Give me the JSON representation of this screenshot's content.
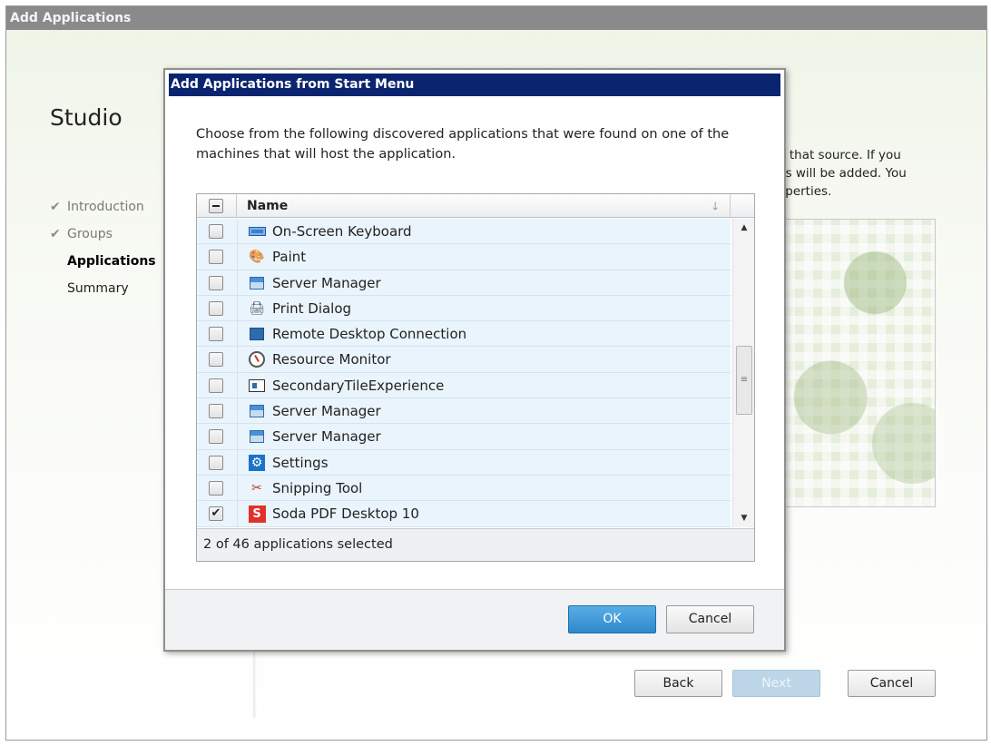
{
  "wizard": {
    "title": "Add Applications",
    "product": "Studio",
    "steps": [
      {
        "label": "Introduction",
        "state": "done"
      },
      {
        "label": "Groups",
        "state": "done"
      },
      {
        "label": "Applications",
        "state": "current"
      },
      {
        "label": "Summary",
        "state": "pending"
      }
    ],
    "background_text": [
      "n that source. If you",
      "ps will be added. You",
      "operties."
    ],
    "buttons": {
      "back": "Back",
      "next": "Next",
      "cancel": "Cancel"
    }
  },
  "dialog": {
    "title": "Add Applications from Start Menu",
    "description": "Choose from the following discovered applications that were found on one of the machines that will host the application.",
    "list": {
      "column_header": "Name",
      "sort_glyph": "🡓",
      "header_checkbox_state": "partial",
      "items": [
        {
          "label": "On-Screen Keyboard",
          "icon": "keyboard-icon",
          "checked": false
        },
        {
          "label": "Paint",
          "icon": "paint-icon",
          "checked": false
        },
        {
          "label": "Server Manager",
          "icon": "server-manager-icon",
          "checked": false
        },
        {
          "label": "Print Dialog",
          "icon": "printer-icon",
          "checked": false
        },
        {
          "label": "Remote Desktop Connection",
          "icon": "remote-desktop-icon",
          "checked": false
        },
        {
          "label": "Resource Monitor",
          "icon": "resource-monitor-icon",
          "checked": false
        },
        {
          "label": "SecondaryTileExperience",
          "icon": "tile-icon",
          "checked": false
        },
        {
          "label": "Server Manager",
          "icon": "server-manager-icon",
          "checked": false
        },
        {
          "label": "Server Manager",
          "icon": "server-manager-icon",
          "checked": false
        },
        {
          "label": "Settings",
          "icon": "settings-gear-icon",
          "checked": false
        },
        {
          "label": "Snipping Tool",
          "icon": "scissors-icon",
          "checked": false
        },
        {
          "label": "Soda PDF Desktop 10",
          "icon": "soda-pdf-icon",
          "checked": true
        }
      ],
      "status": "2 of 46 applications selected"
    },
    "buttons": {
      "ok": "OK",
      "cancel": "Cancel"
    }
  },
  "glyphs": {
    "check": "✔",
    "scroll_up": "▲",
    "scroll_down": "▼",
    "grip": "≡",
    "paint": "🎨",
    "print": "🖨",
    "snip": "✂",
    "gear": "⚙",
    "soda": "S"
  },
  "colors": {
    "dialog_title_bg": "#0a2470",
    "row_bg": "#eaf4fc",
    "primary_button": "#2e88cc",
    "wizard_title_bg": "#8a8a8a"
  }
}
